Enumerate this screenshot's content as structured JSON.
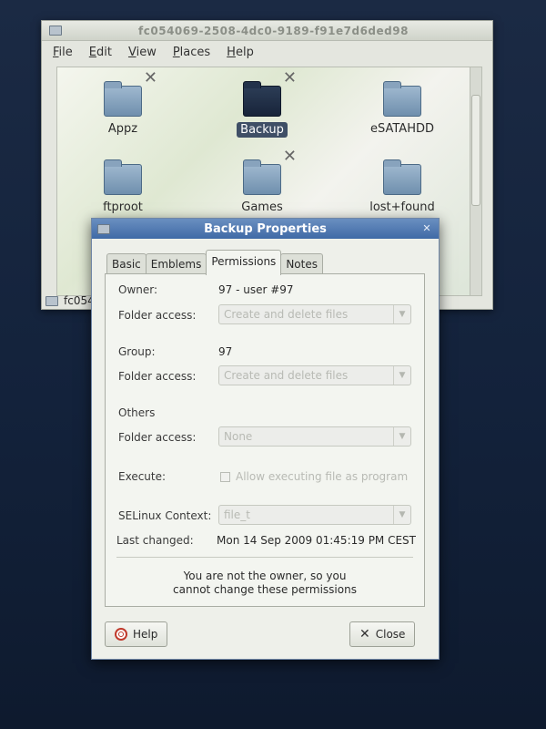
{
  "file_manager": {
    "title": "fc054069-2508-4dc0-9189-f91e7d6ded98",
    "menu": [
      "File",
      "Edit",
      "View",
      "Places",
      "Help"
    ],
    "items": [
      {
        "label": "Appz",
        "emblem": "✕"
      },
      {
        "label": "Backup",
        "emblem": "✕"
      },
      {
        "label": "eSATAHDD",
        "emblem": ""
      },
      {
        "label": "ftproot",
        "emblem": ""
      },
      {
        "label": "Games",
        "emblem": "✕"
      },
      {
        "label": "lost+found",
        "emblem": ""
      }
    ],
    "statusbar_location": "fc054"
  },
  "dialog": {
    "title": "Backup Properties",
    "close_glyph": "✕",
    "tabs": [
      "Basic",
      "Emblems",
      "Permissions",
      "Notes"
    ],
    "owner_label": "Owner:",
    "owner_value": "97 - user #97",
    "folder_access_label": "Folder access:",
    "owner_folder_access": "Create and delete files",
    "group_label": "Group:",
    "group_value": "97",
    "group_folder_access": "Create and delete files",
    "others_label": "Others",
    "others_folder_access": "None",
    "execute_label": "Execute:",
    "execute_option": "Allow executing file as program",
    "selinux_label": "SELinux Context:",
    "selinux_value": "file_t",
    "last_changed_label": "Last changed:",
    "last_changed_value": "Mon 14 Sep 2009 01:45:19 PM CEST",
    "notice_line1": "You are not the owner, so you",
    "notice_line2": "cannot change these permissions",
    "help_button": "Help",
    "close_button": "Close"
  }
}
